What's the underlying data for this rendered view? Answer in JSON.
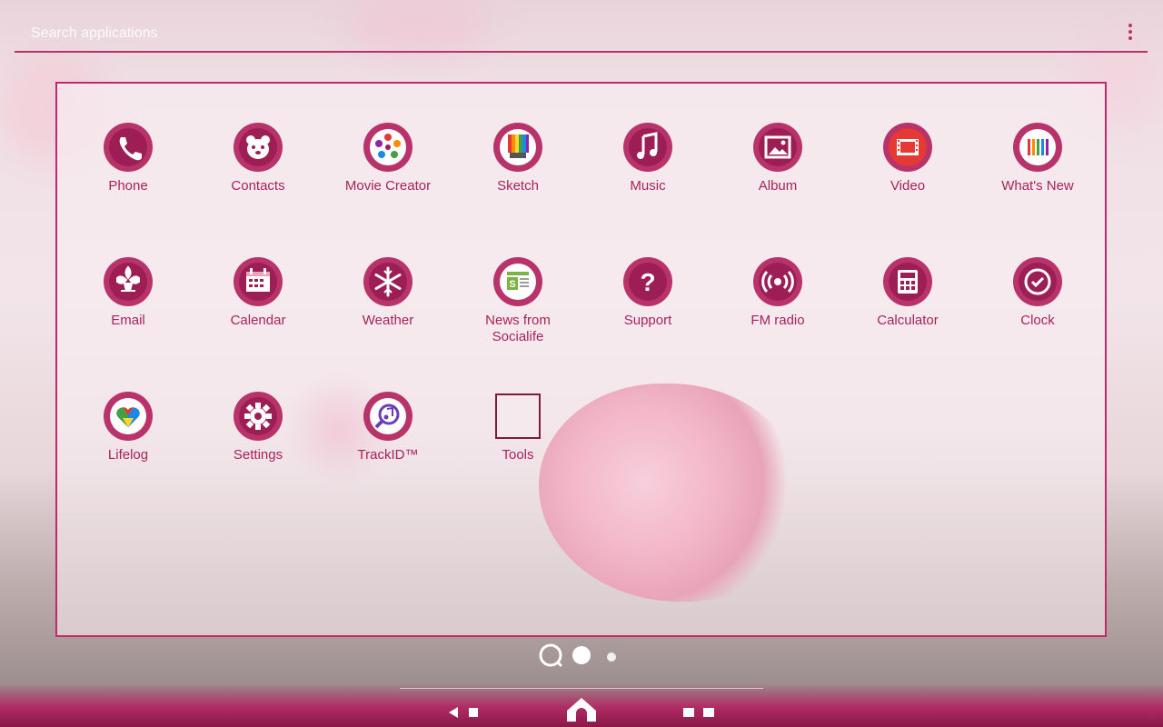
{
  "search": {
    "placeholder": "Search applications"
  },
  "apps": [
    {
      "label": "Phone",
      "icon": "phone-icon"
    },
    {
      "label": "Contacts",
      "icon": "contacts-icon"
    },
    {
      "label": "Movie Creator",
      "icon": "movie-creator-icon"
    },
    {
      "label": "Sketch",
      "icon": "sketch-icon"
    },
    {
      "label": "Music",
      "icon": "music-note-icon"
    },
    {
      "label": "Album",
      "icon": "album-icon"
    },
    {
      "label": "Video",
      "icon": "video-icon"
    },
    {
      "label": "What's New",
      "icon": "whats-new-icon"
    },
    {
      "label": "Email",
      "icon": "email-icon"
    },
    {
      "label": "Calendar",
      "icon": "calendar-icon"
    },
    {
      "label": "Weather",
      "icon": "snowflake-icon"
    },
    {
      "label": "News from Socialife",
      "label_line1": "News from",
      "label_line2": "Socialife",
      "icon": "news-icon"
    },
    {
      "label": "Support",
      "icon": "question-icon"
    },
    {
      "label": "FM radio",
      "icon": "radio-icon"
    },
    {
      "label": "Calculator",
      "icon": "calculator-icon"
    },
    {
      "label": "Clock",
      "icon": "clock-icon"
    },
    {
      "label": "Lifelog",
      "icon": "heart-icon"
    },
    {
      "label": "Settings",
      "icon": "gear-icon"
    },
    {
      "label": "TrackID™",
      "icon": "trackid-icon"
    },
    {
      "label": "Tools",
      "icon": "folder-icon"
    }
  ],
  "colors": {
    "accent": "#c2296a",
    "label": "#a8225c",
    "icon_bg": "#b8336a",
    "icon_dark": "#8c1a4a"
  }
}
